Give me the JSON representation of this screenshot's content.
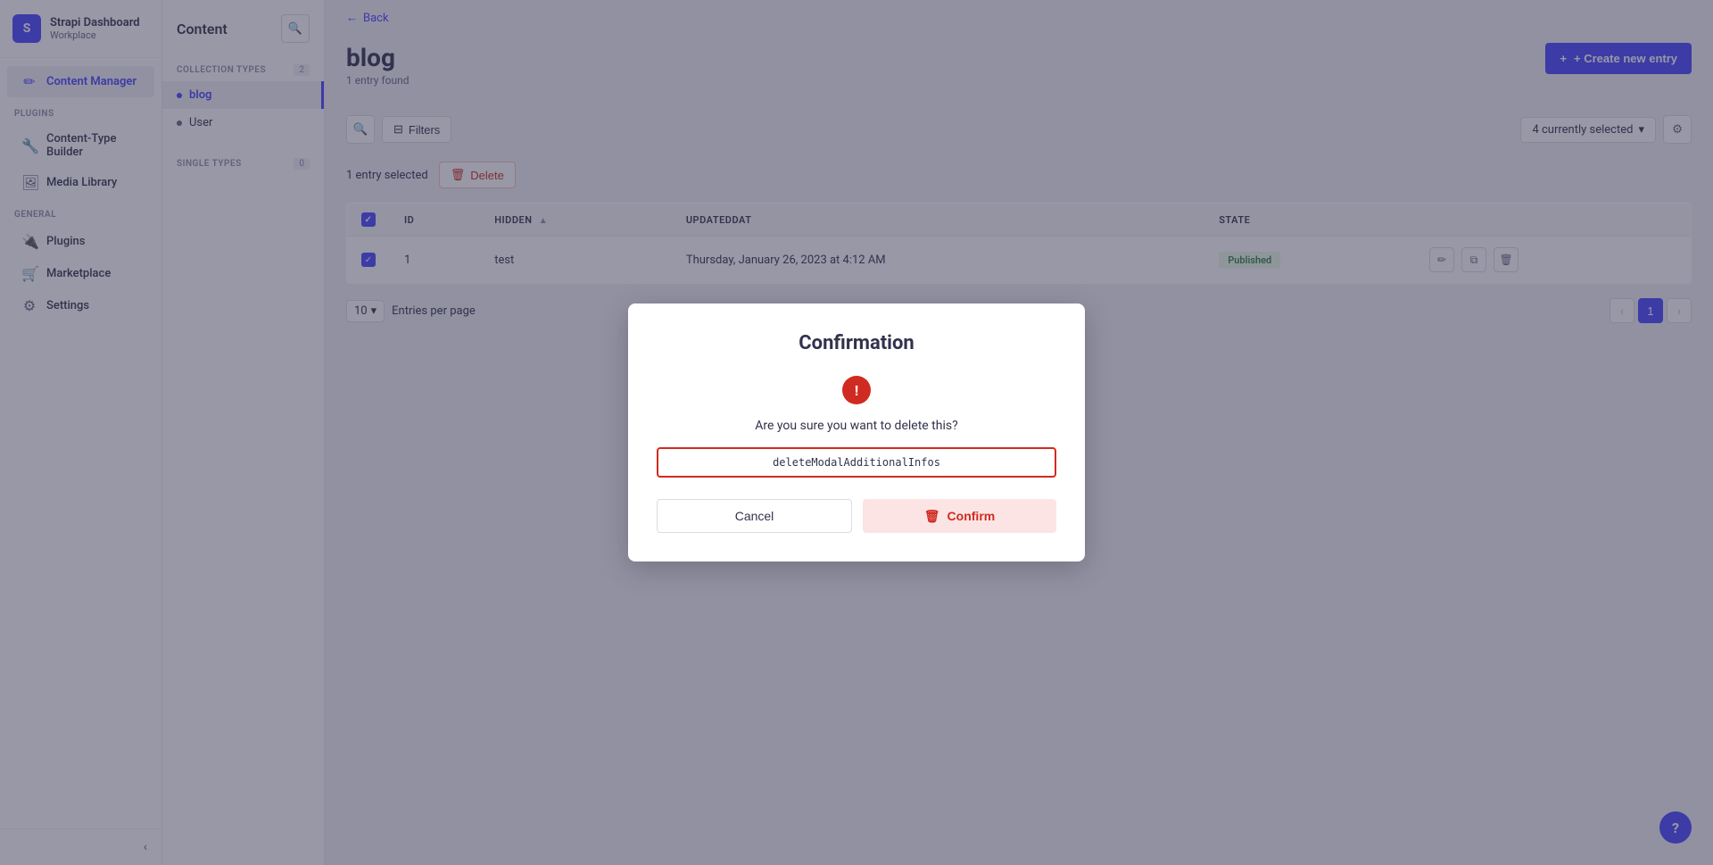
{
  "app": {
    "name": "Strapi Dashboard",
    "workspace": "Workplace"
  },
  "sidebar": {
    "plugins_label": "PLUGINS",
    "general_label": "GENERAL",
    "items": [
      {
        "id": "content-manager",
        "label": "Content Manager",
        "icon": "📄",
        "active": true
      },
      {
        "id": "content-type-builder",
        "label": "Content-Type Builder",
        "icon": "🔧"
      },
      {
        "id": "media-library",
        "label": "Media Library",
        "icon": "🖼️"
      },
      {
        "id": "plugins",
        "label": "Plugins",
        "icon": "🔌"
      },
      {
        "id": "marketplace",
        "label": "Marketplace",
        "icon": "🛒"
      },
      {
        "id": "settings",
        "label": "Settings",
        "icon": "⚙️"
      }
    ],
    "collapse_btn": "‹"
  },
  "content_panel": {
    "title": "Content",
    "collection_types_label": "COLLECTION TYPES",
    "collection_types_count": "2",
    "items": [
      {
        "id": "blog",
        "label": "blog",
        "active": true
      },
      {
        "id": "user",
        "label": "User"
      }
    ],
    "single_types_label": "SINGLE TYPES",
    "single_types_count": "0"
  },
  "page": {
    "back_label": "Back",
    "title": "blog",
    "subtitle": "1 entry found",
    "create_btn": "+ Create new entry"
  },
  "toolbar": {
    "filter_btn": "Filters",
    "selected_label": "4 currently selected",
    "settings_icon": "⚙"
  },
  "selection": {
    "text": "1 entry selected",
    "delete_btn": "Delete"
  },
  "table": {
    "columns": [
      {
        "id": "id",
        "label": "ID"
      },
      {
        "id": "hidden",
        "label": "HIDDEN",
        "sortable": true
      },
      {
        "id": "updatedAt",
        "label": "UPDATEDDAT"
      },
      {
        "id": "state",
        "label": "STATE"
      }
    ],
    "rows": [
      {
        "id": "1",
        "hidden": "test",
        "updatedAt": "Thursday, January 26, 2023 at 4:12 AM",
        "state": "Published",
        "checked": true
      }
    ]
  },
  "pagination": {
    "per_page_label": "Entries per page",
    "per_page_value": "10",
    "current_page": "1"
  },
  "modal": {
    "title": "Confirmation",
    "warning_icon": "!",
    "question": "Are you sure you want to delete this?",
    "code_text": "deleteModalAdditionalInfos",
    "cancel_btn": "Cancel",
    "confirm_btn": "Confirm",
    "confirm_icon": "🗑"
  },
  "help_btn": "?"
}
